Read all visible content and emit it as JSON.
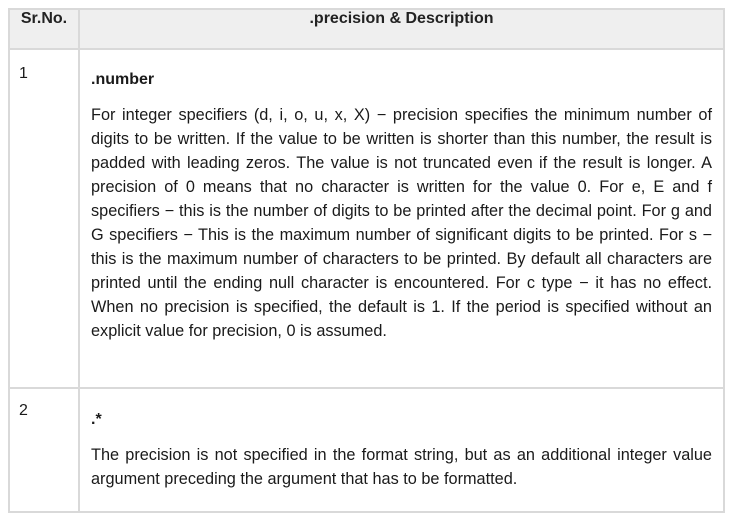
{
  "table": {
    "headers": {
      "sr_no": "Sr.No.",
      "description": ".precision & Description"
    },
    "rows": [
      {
        "sr": "1",
        "term": ".number",
        "description": "For integer specifiers (d, i, o, u, x, X) − precision specifies the minimum number of digits to be written. If the value to be written is shorter than this number, the result is padded with leading zeros. The value is not truncated even if the result is longer. A precision of 0 means that no character is written for the value 0. For e, E and f specifiers − this is the number of digits to be printed after the decimal point. For g and G specifiers − This is the maximum number of significant digits to be printed. For s − this is the maximum number of characters to be printed. By default all characters are printed until the ending null character is encountered. For c type − it has no effect. When no precision is specified, the default is 1. If the period is specified without an explicit value for precision, 0 is assumed."
      },
      {
        "sr": "2",
        "term": ".*",
        "description": "The precision is not specified in the format string, but as an additional integer value argument preceding the argument that has to be formatted."
      }
    ]
  }
}
